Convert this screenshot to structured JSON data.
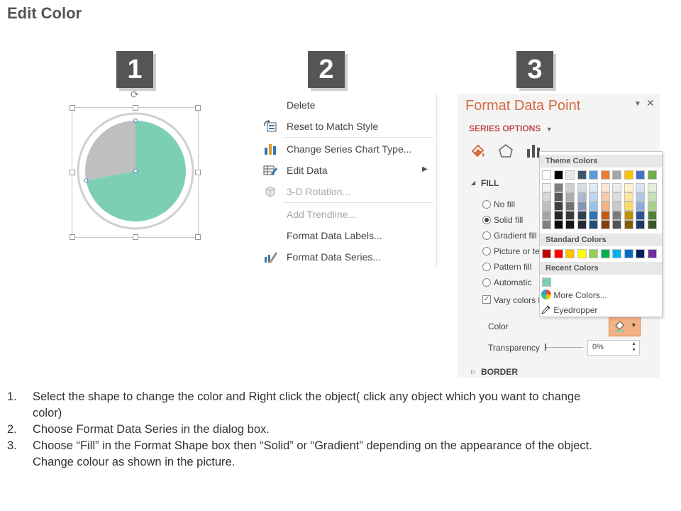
{
  "title": "Edit Color",
  "steps": [
    "1",
    "2",
    "3"
  ],
  "panel1": {
    "pie": {
      "segments": [
        {
          "value": 72,
          "color": "#7ccfb5"
        },
        {
          "value": 28,
          "color": "#bfbfbf"
        }
      ]
    }
  },
  "context_menu": {
    "items": [
      {
        "label": "Delete",
        "icon": "none",
        "disabled": false
      },
      {
        "label": "Reset to Match Style",
        "icon": "reset-style-icon",
        "disabled": false
      },
      {
        "label": "Change Series Chart Type...",
        "icon": "bar-chart-icon",
        "disabled": false
      },
      {
        "label": "Edit Data",
        "icon": "edit-data-icon",
        "disabled": false,
        "submenu": true
      },
      {
        "label": "3-D Rotation...",
        "icon": "cube-icon",
        "disabled": true
      },
      {
        "label": "Add Trendline...",
        "icon": "none",
        "disabled": true
      },
      {
        "label": "Format Data Labels...",
        "icon": "none",
        "disabled": false
      },
      {
        "label": "Format Data Series...",
        "icon": "format-series-icon",
        "disabled": false
      }
    ]
  },
  "format_pane": {
    "title": "Format Data Point",
    "series_options": "SERIES OPTIONS",
    "fill_section": "FILL",
    "fill_options": [
      {
        "label": "No fill",
        "selected": false
      },
      {
        "label": "Solid fill",
        "selected": true
      },
      {
        "label": "Gradient fill",
        "selected": false
      },
      {
        "label": "Picture or te",
        "selected": false
      },
      {
        "label": "Pattern fill",
        "selected": false
      },
      {
        "label": "Automatic",
        "selected": false
      }
    ],
    "vary_colors_label": "Vary colors b",
    "vary_colors_checked": true,
    "color_label": "Color",
    "transparency_label": "Transparency",
    "transparency_value": "0%",
    "border_section": "BORDER",
    "accent_color": "#d36b43"
  },
  "palette": {
    "theme_colors_label": "Theme Colors",
    "theme_top_row": [
      "#ffffff",
      "#000000",
      "#e7e6e6",
      "#44546a",
      "#5b9bd5",
      "#ed7d31",
      "#a5a5a5",
      "#ffc000",
      "#4472c4",
      "#70ad47"
    ],
    "theme_shades": [
      [
        "#f2f2f2",
        "#7f7f7f",
        "#d0cece",
        "#d6dce4",
        "#deebf6",
        "#fbe5d5",
        "#ededed",
        "#fff2cc",
        "#d9e2f3",
        "#e2efd9"
      ],
      [
        "#d8d8d8",
        "#595959",
        "#aeabab",
        "#adb9ca",
        "#bdd7ee",
        "#f7cbac",
        "#dbdbdb",
        "#fee599",
        "#b4c6e7",
        "#c5e0b3"
      ],
      [
        "#bfbfbf",
        "#3f3f3f",
        "#757070",
        "#8496b0",
        "#9dc3e6",
        "#f4b183",
        "#c9c9c9",
        "#ffd965",
        "#8eaadb",
        "#a8d08d"
      ],
      [
        "#a5a5a5",
        "#262626",
        "#3a3838",
        "#323f4f",
        "#2e75b5",
        "#c55a11",
        "#7b7b7b",
        "#bf9000",
        "#2f5496",
        "#538135"
      ],
      [
        "#7f7f7f",
        "#0c0c0c",
        "#171616",
        "#222a35",
        "#1e4e79",
        "#833c0b",
        "#525252",
        "#7f6000",
        "#1f3864",
        "#375623"
      ]
    ],
    "standard_colors_label": "Standard Colors",
    "standard_colors": [
      "#c00000",
      "#ff0000",
      "#ffc000",
      "#ffff00",
      "#92d050",
      "#00b050",
      "#00b0f0",
      "#0070c0",
      "#002060",
      "#7030a0"
    ],
    "recent_colors_label": "Recent Colors",
    "recent_colors": [
      "#7ccfb5"
    ],
    "more_colors_label": "More Colors...",
    "eyedropper_label": "Eyedropper"
  },
  "instructions": [
    {
      "num": "1.",
      "lines": [
        "Select the shape to change the color and Right click the object( click any object which you want to change",
        "color)"
      ]
    },
    {
      "num": "2.",
      "lines": [
        "Choose Format Data Series in the dialog box."
      ]
    },
    {
      "num": "3.",
      "lines": [
        "Choose “Fill” in the Format Shape box then “Solid” or “Gradient” depending on the appearance of the object.",
        "Change colour as shown in the picture."
      ]
    }
  ]
}
